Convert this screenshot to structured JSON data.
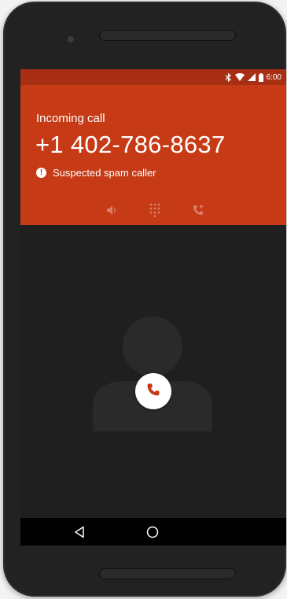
{
  "status_bar": {
    "time": "6:00",
    "icons": [
      "bluetooth-icon",
      "wifi-icon",
      "signal-icon",
      "battery-icon"
    ]
  },
  "call": {
    "label": "Incoming call",
    "number": "+1 402-786-8637",
    "spam_icon": "!",
    "spam_text": "Suspected spam caller"
  },
  "actions": {
    "icons": [
      "speaker-icon",
      "dialpad-icon",
      "add-call-icon"
    ]
  },
  "answer": {
    "icon": "phone-icon"
  },
  "nav": {
    "icons": [
      "back-icon",
      "home-icon"
    ]
  },
  "colors": {
    "header": "#c63a16",
    "status_bar": "#a92f14",
    "screen_bg": "#1f1f1f"
  }
}
